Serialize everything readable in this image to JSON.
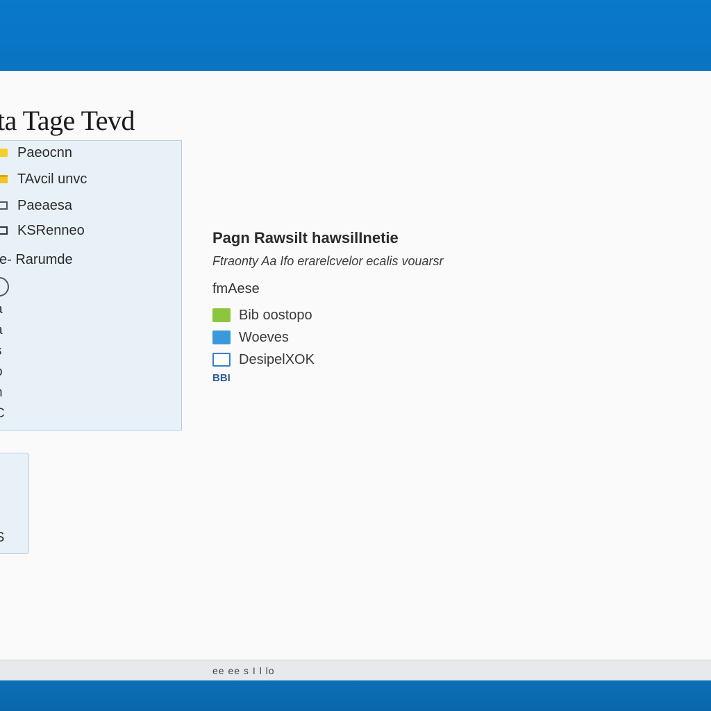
{
  "app": {
    "title": "ta Tage Tevd"
  },
  "sidebar": {
    "items": [
      {
        "label": "Paeocnn",
        "icon": "yellow-square-icon"
      },
      {
        "label": "TAvcil unvc",
        "icon": "folder-icon"
      },
      {
        "label": "Paeaesa",
        "icon": "square-icon"
      },
      {
        "label": "KSRenneo",
        "icon": "square-icon"
      },
      {
        "label": "e- Rarumde",
        "icon": ""
      }
    ],
    "sub_items": [
      "a",
      "a",
      "s",
      "o",
      "n",
      "C"
    ]
  },
  "small_panel": {
    "label": "S"
  },
  "content": {
    "heading": "Pagn Rawsilt hawsilInetie",
    "description": "Ftraonty Aa Ifo erarelcvelor ecalis vouarsr",
    "subheading": "fmAese",
    "options": [
      {
        "label": "Bib oostopo",
        "icon": "green-block-icon"
      },
      {
        "label": "Woeves",
        "icon": "blue-block-icon"
      },
      {
        "label": "DesipelXOK",
        "icon": "document-icon"
      }
    ],
    "extra": "BBI"
  },
  "status_bar": {
    "text": "ee ee s I l lo"
  },
  "colors": {
    "desktop": "#0a75c4",
    "window_bg": "#fafafa",
    "sidebar_bg": "#e9f1f8",
    "accent_green": "#8cc63f",
    "accent_blue": "#3a9ad9"
  }
}
